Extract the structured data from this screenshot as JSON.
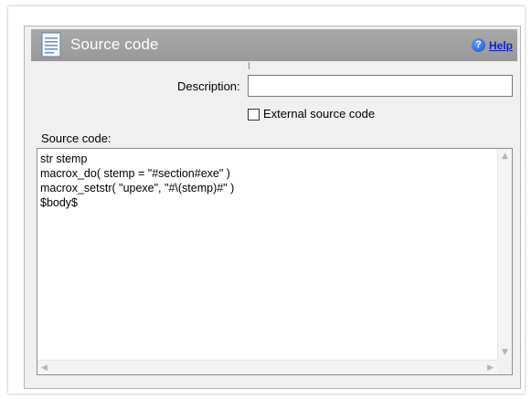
{
  "header": {
    "title": "Source code",
    "help_label": "Help",
    "icon": "document-icon"
  },
  "form": {
    "description_label": "Description:",
    "description_value": "",
    "external_label": "External source code",
    "external_checked": false,
    "source_label": "Source code:",
    "source_value": "str stemp\nmacrox_do( stemp = \"#section#exe\" )\nmacrox_setstr( \"upexe\", \"#\\(stemp)#\" )\n$body$"
  },
  "colors": {
    "titlebar": "#a0a0a0",
    "panel": "#f0f0f0",
    "help_link": "#0a1fd6"
  }
}
